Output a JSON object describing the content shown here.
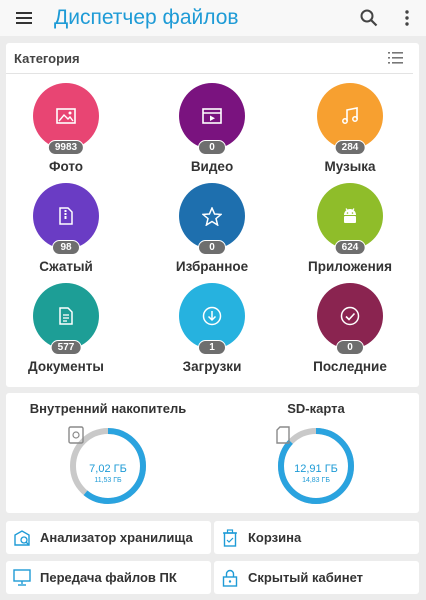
{
  "app_title": "Диспетчер файлов",
  "colors": {
    "accent": "#1e9bd6"
  },
  "categories": {
    "title": "Категория",
    "items": [
      {
        "label": "Фото",
        "count": "9983",
        "color": "#e84573",
        "icon": "image-icon"
      },
      {
        "label": "Видео",
        "count": "0",
        "color": "#7a137f",
        "icon": "film-icon"
      },
      {
        "label": "Музыка",
        "count": "284",
        "color": "#f7a030",
        "icon": "music-note-icon"
      },
      {
        "label": "Сжатый",
        "count": "98",
        "color": "#6a3cc4",
        "icon": "archive-icon"
      },
      {
        "label": "Избранное",
        "count": "0",
        "color": "#1e6fae",
        "icon": "star-icon"
      },
      {
        "label": "Приложения",
        "count": "624",
        "color": "#8fbd2a",
        "icon": "android-icon"
      },
      {
        "label": "Документы",
        "count": "577",
        "color": "#1d9e96",
        "icon": "document-icon"
      },
      {
        "label": "Загрузки",
        "count": "1",
        "color": "#26b2df",
        "icon": "download-icon"
      },
      {
        "label": "Последние",
        "count": "0",
        "color": "#8a2450",
        "icon": "check-circle-icon"
      }
    ]
  },
  "storage": {
    "internal": {
      "title": "Внутренний накопитель",
      "used": "7,02 ГБ",
      "total": "11,53 ГБ",
      "fraction": 0.61
    },
    "sd": {
      "title": "SD-карта",
      "used": "12,91 ГБ",
      "total": "14,83 ГБ",
      "fraction": 0.87
    }
  },
  "tools": {
    "analyzer": "Анализатор хранилища",
    "trash": "Корзина",
    "pc_transfer": "Передача файлов ПК",
    "hidden": "Скрытый кабинет"
  }
}
